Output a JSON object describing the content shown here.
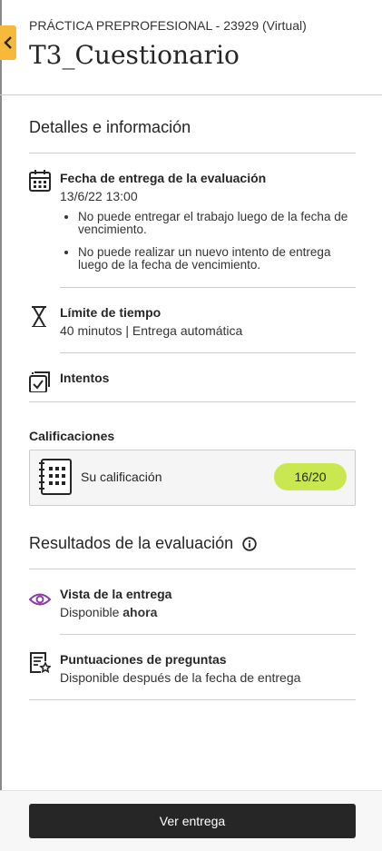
{
  "header": {
    "course": "PRÁCTICA PREPROFESIONAL - 23929 (Virtual)",
    "title": "T3_Cuestionario"
  },
  "details": {
    "section_title": "Detalles e información",
    "due": {
      "icon": "calendar-icon",
      "label": "Fecha de entrega de la evaluación",
      "date": "13/6/22 13:00",
      "notes": [
        "No puede entregar el trabajo luego de la fecha de vencimiento.",
        "No puede realizar un nuevo intento de entrega luego de la fecha de vencimiento."
      ]
    },
    "time_limit": {
      "icon": "hourglass-icon",
      "label": "Límite de tiempo",
      "value": "40 minutos | Entrega automática"
    },
    "attempts": {
      "icon": "attempts-icon",
      "label": "Intentos"
    }
  },
  "grades": {
    "section_label": "Calificaciones",
    "icon": "gradebook-icon",
    "label": "Su calificación",
    "score": "16/20",
    "badge_color": "#c9e84f"
  },
  "results": {
    "section_title": "Resultados de la evaluación",
    "info_icon": "info-icon",
    "submission_view": {
      "icon": "eye-icon",
      "label": "Vista de la entrega",
      "status_prefix": "Disponible",
      "status_emphasis": "ahora"
    },
    "question_scores": {
      "icon": "question-score-icon",
      "label": "Puntuaciones de preguntas",
      "status": "Disponible después de la fecha de entrega"
    }
  },
  "footer": {
    "primary_button": "Ver entrega"
  },
  "colors": {
    "back_tab": "#f6b93b",
    "primary_button": "#262626",
    "eye_icon": "#8e3ba8"
  }
}
